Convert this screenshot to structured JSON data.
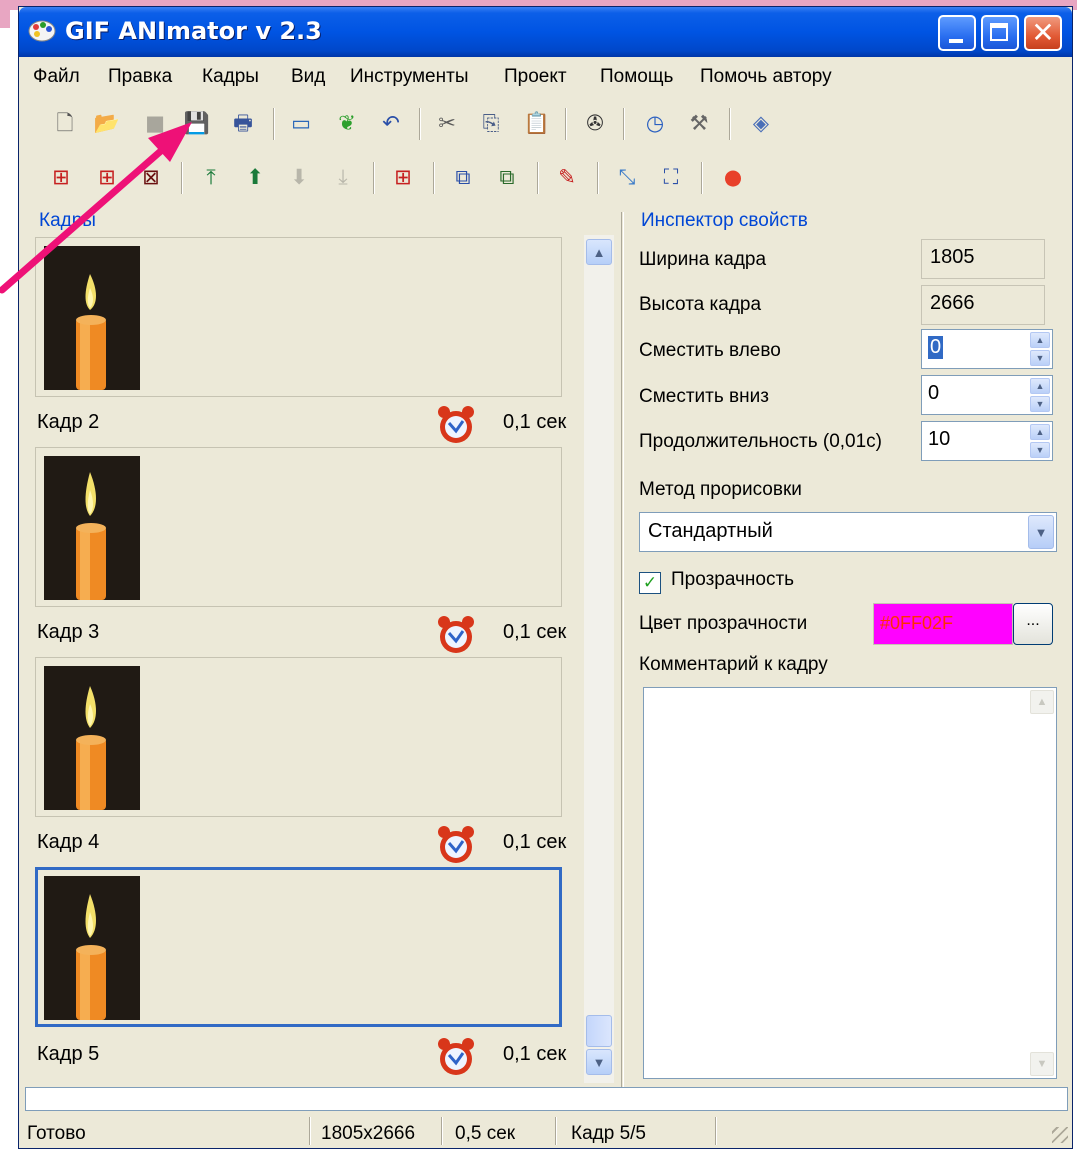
{
  "window": {
    "title": "GIF ANImator v 2.3",
    "controls": {
      "minimize": "_",
      "maximize": "□",
      "close": "✕"
    }
  },
  "menu": [
    "Файл",
    "Правка",
    "Кадры",
    "Вид",
    "Инструменты",
    "Проект",
    "Помощь",
    "Помочь автору"
  ],
  "toolbar1": [
    {
      "name": "new-icon",
      "glyph": "🗋"
    },
    {
      "name": "open-icon",
      "glyph": "📂"
    },
    {
      "name": "save-disabled-icon",
      "glyph": "■"
    },
    {
      "name": "save-as-icon",
      "glyph": "💾"
    },
    {
      "name": "print-icon",
      "glyph": "🖶"
    },
    {
      "name": "preview-icon",
      "glyph": "▭"
    },
    {
      "name": "animate-icon",
      "glyph": "❦"
    },
    {
      "name": "undo-icon",
      "glyph": "↶"
    },
    {
      "name": "cut-icon",
      "glyph": "✂"
    },
    {
      "name": "copy-icon",
      "glyph": "⎘"
    },
    {
      "name": "paste-icon",
      "glyph": "📋"
    },
    {
      "name": "film-icon",
      "glyph": "✇"
    },
    {
      "name": "clock-icon",
      "glyph": "◷"
    },
    {
      "name": "tools-icon",
      "glyph": "⚒"
    },
    {
      "name": "web-icon",
      "glyph": "◈"
    }
  ],
  "toolbar2": [
    {
      "name": "add-frame-icon",
      "glyph": "⊞"
    },
    {
      "name": "insert-frame-icon",
      "glyph": "⊞"
    },
    {
      "name": "delete-frame-icon",
      "glyph": "⊠"
    },
    {
      "name": "move-top-icon",
      "glyph": "⤒"
    },
    {
      "name": "move-up-icon",
      "glyph": "⬆"
    },
    {
      "name": "move-down-icon",
      "glyph": "⬇"
    },
    {
      "name": "move-bottom-icon",
      "glyph": "⤓"
    },
    {
      "name": "duplicate-frame-icon",
      "glyph": "⊞"
    },
    {
      "name": "import-frames-icon",
      "glyph": "⧉"
    },
    {
      "name": "export-frames-icon",
      "glyph": "⧉"
    },
    {
      "name": "edit-frame-icon",
      "glyph": "✎"
    },
    {
      "name": "resize-icon",
      "glyph": "⤡"
    },
    {
      "name": "crop-icon",
      "glyph": "⛶"
    },
    {
      "name": "palette-icon",
      "glyph": "●"
    }
  ],
  "frames_panel": {
    "label": "Кадры",
    "frames": [
      {
        "name": "Кадр 2",
        "delay": "0,1 сек"
      },
      {
        "name": "Кадр 3",
        "delay": "0,1 сек"
      },
      {
        "name": "Кадр 4",
        "delay": "0,1 сек"
      },
      {
        "name": "Кадр 5",
        "delay": "0,1 сек",
        "selected": true
      }
    ]
  },
  "inspector": {
    "label": "Инспектор свойств",
    "frame_width": {
      "label": "Ширина кадра",
      "value": "1805"
    },
    "frame_height": {
      "label": "Высота кадра",
      "value": "2666"
    },
    "offset_left": {
      "label": "Сместить влево",
      "value": "0"
    },
    "offset_down": {
      "label": "Сместить вниз",
      "value": "0"
    },
    "duration": {
      "label": "Продолжительность (0,01с)",
      "value": "10"
    },
    "draw_method": {
      "label": "Метод прорисовки",
      "value": "Стандартный"
    },
    "transparency": {
      "label": "Прозрачность",
      "checked": true
    },
    "transparency_color": {
      "label": "Цвет прозрачности",
      "value": "#0FF02F",
      "swatch": "#ff02ff",
      "button": "..."
    },
    "comment": {
      "label": "Комментарий к кадру",
      "value": ""
    }
  },
  "status": {
    "state": "Готово",
    "size": "1805x2666",
    "duration": "0,5 сек",
    "frame": "Кадр 5/5"
  },
  "colors": {
    "title_blue": "#0054e3",
    "window_bg": "#ece9d8",
    "annotation_arrow": "#ee1177",
    "selection": "#316ac5"
  }
}
